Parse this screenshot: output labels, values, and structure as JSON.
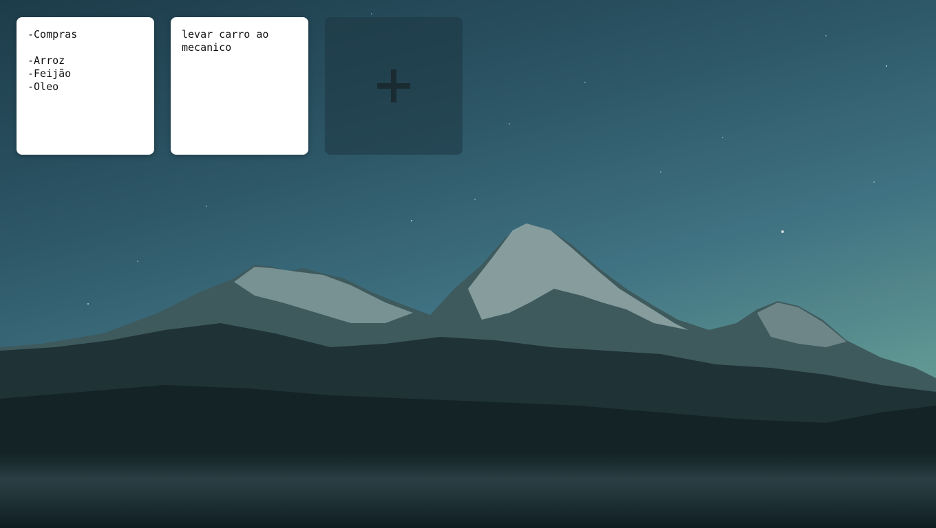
{
  "notes": [
    {
      "text": "-Compras\n\n-Arroz\n-Feijão\n-Oleo"
    },
    {
      "text": "levar carro ao mecanico"
    }
  ],
  "add_button": {
    "icon": "plus-icon"
  },
  "colors": {
    "note_background": "#ffffff",
    "add_button_background": "#2a4650",
    "plus_color": "#1a2b31"
  }
}
